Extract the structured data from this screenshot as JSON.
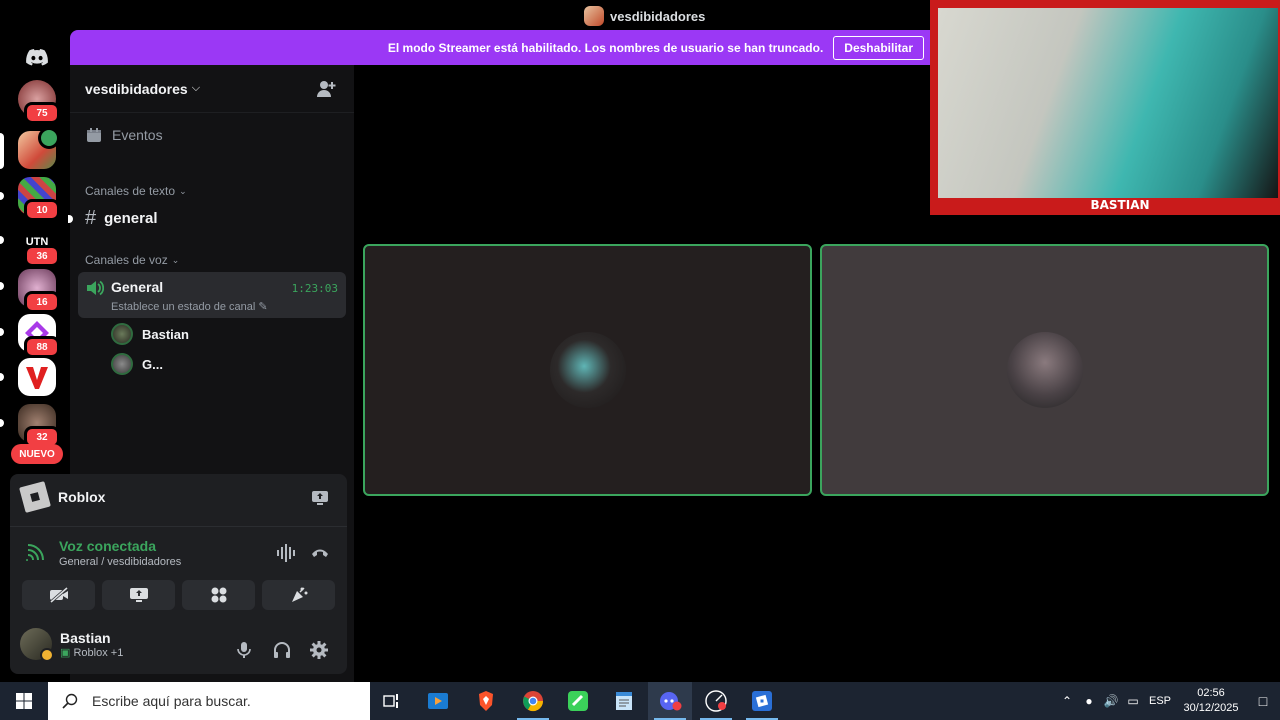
{
  "window": {
    "title": "vesdibidadores"
  },
  "banner": {
    "text": "El modo Streamer está habilitado. Los nombres de usuario se han truncado.",
    "button": "Deshabilitar",
    "color": "#9b38f5"
  },
  "servers": [
    {
      "badge": "75"
    },
    {
      "badge": ""
    },
    {
      "badge": "10"
    },
    {
      "label": "UTN",
      "badge": "36"
    },
    {
      "badge": "16"
    },
    {
      "badge": "88"
    },
    {
      "badge": ""
    },
    {
      "badge": "32"
    }
  ],
  "nuevo_label": "NUEVO",
  "sidebar": {
    "guild_name": "vesdibidadores",
    "events_label": "Eventos",
    "text_category": "Canales de texto",
    "text_channel": "general",
    "voice_category": "Canales de voz",
    "voice_channel": {
      "name": "General",
      "timer": "1:23:03",
      "status_placeholder": "Establece un estado de canal"
    },
    "voice_users": [
      "Bastian",
      "G..."
    ]
  },
  "panel": {
    "activity": "Roblox",
    "voice_title": "Voz conectada",
    "voice_sub": "General / vesdibidadores",
    "user_name": "Bastian",
    "user_activity": "Roblox +1"
  },
  "webcam": {
    "label": "BASTIAN"
  },
  "taskbar": {
    "search_placeholder": "Escribe aquí para buscar.",
    "lang": "ESP",
    "time": "02:56",
    "date": "30/12/2025"
  },
  "colors": {
    "accent_green": "#3ba55d",
    "badge_red": "#f23f43",
    "sidebar_bg": "#121214"
  }
}
